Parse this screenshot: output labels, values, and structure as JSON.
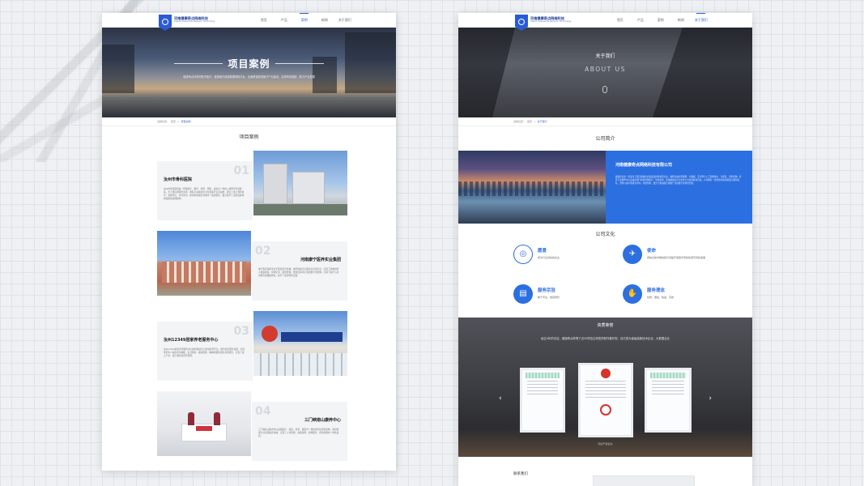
{
  "logo": {
    "cn": "河南健康奇点网络科技",
    "en": "Health Singularity Network Technology"
  },
  "left_page": {
    "nav": [
      "首页",
      "产品",
      "案例",
      "新闻",
      "关于我们"
    ],
    "active_nav_index": 2,
    "banner_title": "项目案例",
    "banner_sub": "健康奇点持有的数字医疗、健康医疗健康数据网络平台、全面覆盖智慧医疗产业建设，实现有效链接，助力产业发展",
    "breadcrumb": {
      "label": "当前位置：",
      "home": "首页",
      "sep": ">",
      "current": "项目案例"
    },
    "section_title": "项目案例",
    "cases": [
      {
        "num": "01",
        "name": "汝州市骨科医院",
        "desc": "汝州市骨科医院是一所集医疗、教学、科研、预防、康复为一体的二级甲等专科医院，为了更好地服务患者，我院引进健康奇点智慧医疗信息系统，建立了线上预约挂号、智能导诊、诊间支付、检查检验报告查询等一站式服务，极大提升了患者就医体验和医院管理效率。"
      },
      {
        "num": "02",
        "name": "河南康宁医养实业集团",
        "desc": "康宁医养集团专注于医养结合领域，依托健康奇点医养信息化平台，实现了机构内老人健康档案、护理记录、膳食管理、费用结算等全流程数字化管理，打通了医疗与养老服务的数据壁垒，提升了医养服务质量。"
      },
      {
        "num": "03",
        "name": "汝州12349居家养老服务中心",
        "desc": "汝州12349居家养老服务中心依托健康奇点智慧养老平台，整合社区服务资源，为辖区老年人提供紧急救援、生活照料、健康管理、精神慰藉等居家养老服务，实现了线上下单、线下服务的闭环管理。"
      },
      {
        "num": "04",
        "name": "三门峡南山康养中心",
        "desc": "三门峡南山康养中心是集医疗、康复、养老、旅居为一体的综合性康养机构，通过健康奇点智慧康养系统，实现了入住管理、健康监测、护理服务、费用管理的一体化运营。"
      }
    ]
  },
  "right_page": {
    "nav": [
      "首页",
      "产品",
      "案例",
      "新闻",
      "关于我们"
    ],
    "active_nav_index": 4,
    "about_title": "关于我们",
    "about_sub": "ABOUT US",
    "breadcrumb": {
      "label": "当前位置：",
      "home": "首页",
      "sep": ">",
      "current": "关于我们"
    },
    "profile_title": "公司简介",
    "company_name": "河南健康奇点网络科技有限公司",
    "company_desc": "健康奇点是一家专注于医疗健康信息化建设的科技型企业，依托先进的互联网、大数据、云计算与人工智能技术，为医院、养老机构、社区卫生服务中心及政府部门提供智慧医疗、智慧养老、区域健康信息平台等全方位的解决方案。公司拥有一支经验丰富的研发与服务团队，坚持以客户需求为导向，持续创新，致力于推动医疗健康产业的数字化转型升级。",
    "culture_title": "公司文化",
    "culture": [
      {
        "title": "愿景",
        "desc": "成为行业领先的企业",
        "icon": "target-icon",
        "style": "outline"
      },
      {
        "title": "使命",
        "desc": "用信息技术推动和引领医疗健康养老的和谐可持续发展",
        "icon": "bird-icon",
        "style": "solid"
      },
      {
        "title": "服务宗旨",
        "desc": "精于专注、成就所托",
        "icon": "book-icon",
        "style": "solid"
      },
      {
        "title": "服务理念",
        "desc": "优质、便捷、快速、高效",
        "icon": "handshake-icon",
        "style": "solid"
      }
    ],
    "honor_title": "资质荣誉",
    "honor_desc": "经过4年的沉淀，健康奇点获得了近20项自主研发的软件著作权，目已成为省级高新技术企业、大数据企业",
    "honor_caption": "知识产权证书",
    "contact_title": "联系我们"
  },
  "colors": {
    "brand_blue": "#2c6fe0",
    "nav_active": "#2a5bd7"
  }
}
